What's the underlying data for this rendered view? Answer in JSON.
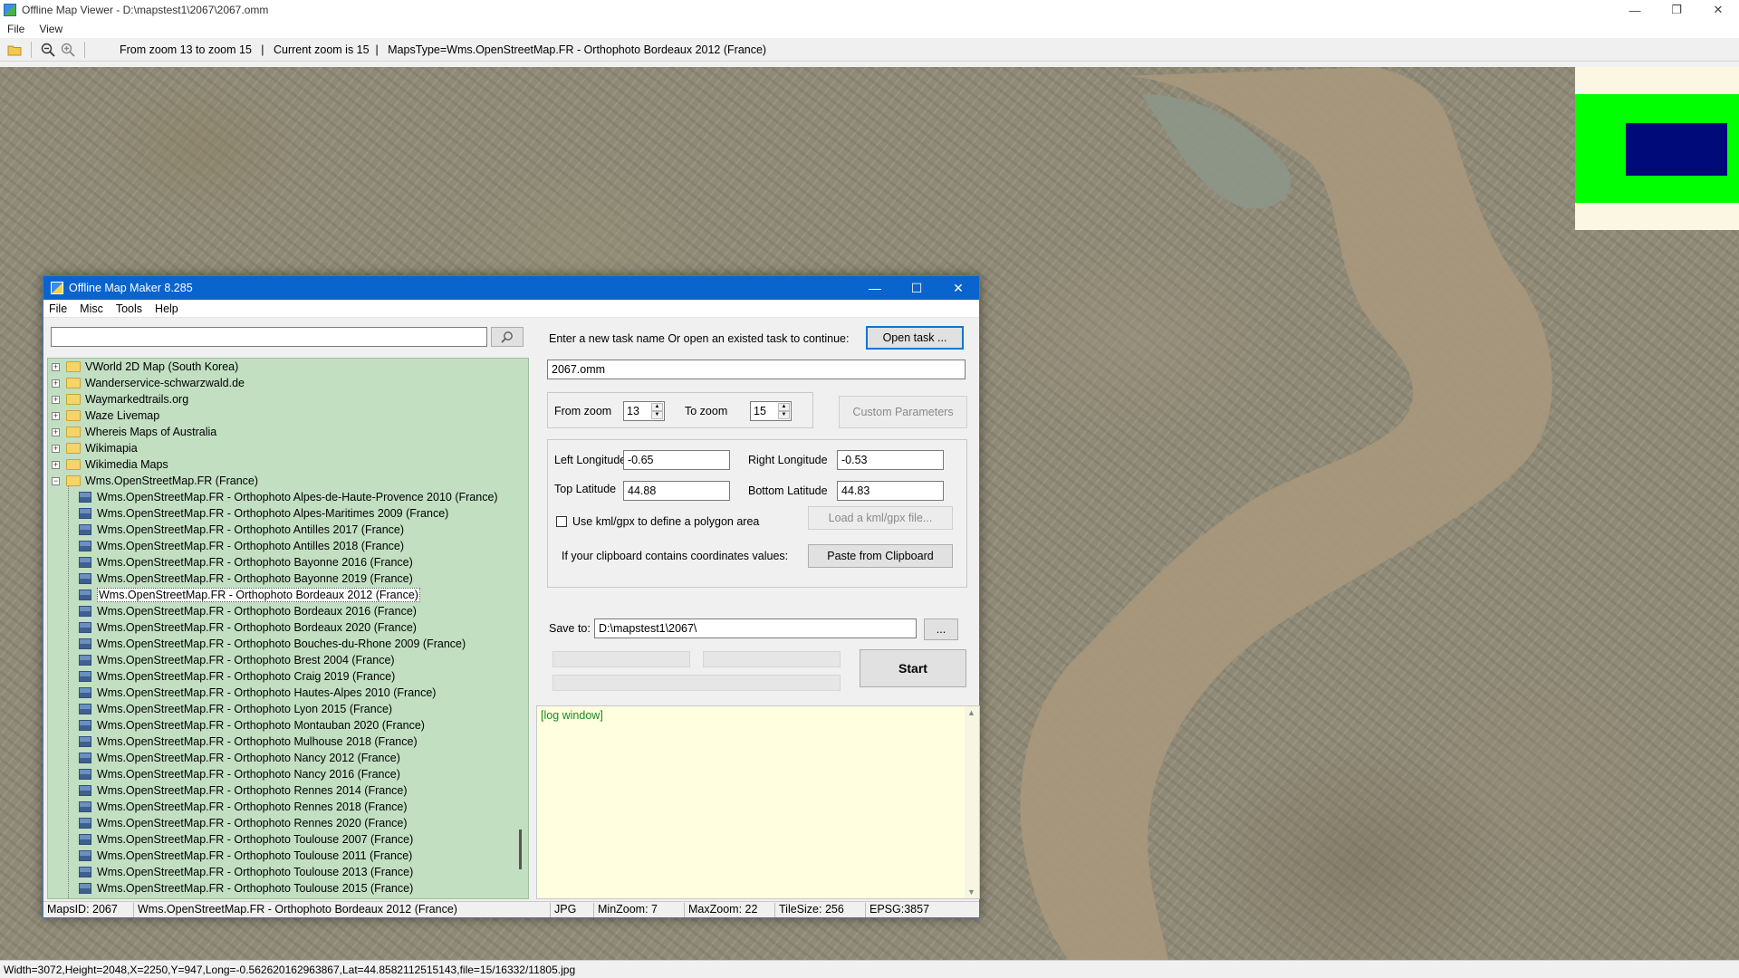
{
  "viewer": {
    "title": "Offline Map Viewer - D:\\mapstest1\\2067\\2067.omm",
    "menu": [
      "File",
      "View"
    ],
    "toolbar_status": "From zoom 13 to zoom 15   |   Current zoom is 15  |   MapsType=Wms.OpenStreetMap.FR - Orthophoto Bordeaux 2012 (France)",
    "status": "Width=3072,Height=2048,X=2250,Y=947,Long=-0.562620162963867,Lat=44.8582112515143,file=15/16332/11805.jpg",
    "icons": [
      "open-folder-icon",
      "zoom-out-icon",
      "zoom-in-icon"
    ],
    "colors": {
      "overview_bg": "#fbf7e3",
      "overview_area": "#00ff00",
      "overview_view": "#000a78",
      "river": "#a6977c"
    }
  },
  "dialog": {
    "title": "Offline Map Maker 8.285",
    "menu": [
      "File",
      "Misc",
      "Tools",
      "Help"
    ],
    "search": {
      "value": "",
      "placeholder": ""
    },
    "tree": {
      "folders": [
        "VWorld 2D Map (South Korea)",
        "Wanderservice-schwarzwald.de",
        "Waymarkedtrails.org",
        "Waze Livemap",
        "Whereis Maps of Australia",
        "Wikimapia",
        "Wikimedia Maps"
      ],
      "expanded_folder": "Wms.OpenStreetMap.FR (France)",
      "items": [
        "Wms.OpenStreetMap.FR - Orthophoto Alpes-de-Haute-Provence 2010 (France)",
        "Wms.OpenStreetMap.FR - Orthophoto Alpes-Maritimes 2009 (France)",
        "Wms.OpenStreetMap.FR - Orthophoto Antilles 2017 (France)",
        "Wms.OpenStreetMap.FR - Orthophoto Antilles 2018 (France)",
        "Wms.OpenStreetMap.FR - Orthophoto Bayonne 2016 (France)",
        "Wms.OpenStreetMap.FR - Orthophoto Bayonne 2019 (France)",
        "Wms.OpenStreetMap.FR - Orthophoto Bordeaux 2012 (France)",
        "Wms.OpenStreetMap.FR - Orthophoto Bordeaux 2016 (France)",
        "Wms.OpenStreetMap.FR - Orthophoto Bordeaux 2020 (France)",
        "Wms.OpenStreetMap.FR - Orthophoto Bouches-du-Rhone 2009 (France)",
        "Wms.OpenStreetMap.FR - Orthophoto Brest 2004 (France)",
        "Wms.OpenStreetMap.FR - Orthophoto Craig 2019 (France)",
        "Wms.OpenStreetMap.FR - Orthophoto Hautes-Alpes 2010 (France)",
        "Wms.OpenStreetMap.FR - Orthophoto Lyon 2015 (France)",
        "Wms.OpenStreetMap.FR - Orthophoto Montauban 2020 (France)",
        "Wms.OpenStreetMap.FR - Orthophoto Mulhouse 2018 (France)",
        "Wms.OpenStreetMap.FR - Orthophoto Nancy 2012 (France)",
        "Wms.OpenStreetMap.FR - Orthophoto Nancy 2016 (France)",
        "Wms.OpenStreetMap.FR - Orthophoto Rennes 2014 (France)",
        "Wms.OpenStreetMap.FR - Orthophoto Rennes 2018 (France)",
        "Wms.OpenStreetMap.FR - Orthophoto Rennes 2020 (France)",
        "Wms.OpenStreetMap.FR - Orthophoto Toulouse 2007 (France)",
        "Wms.OpenStreetMap.FR - Orthophoto Toulouse 2011 (France)",
        "Wms.OpenStreetMap.FR - Orthophoto Toulouse 2013 (France)",
        "Wms.OpenStreetMap.FR - Orthophoto Toulouse 2015 (France)"
      ],
      "selected_item": "Wms.OpenStreetMap.FR - Orthophoto Bordeaux 2012 (France)",
      "tree_bg": "#c2dfc2"
    },
    "task": {
      "prompt": "Enter a new task name Or open an existed task to continue:",
      "open_button": "Open task ...",
      "name_value": "2067.omm"
    },
    "zoom": {
      "from_label": "From zoom",
      "from_value": "13",
      "to_label": "To zoom",
      "to_value": "15",
      "custom_button": "Custom Parameters"
    },
    "coords": {
      "left_lon_label": "Left Longitude",
      "left_lon": "-0.65",
      "right_lon_label": "Right Longitude",
      "right_lon": "-0.53",
      "top_lat_label": "Top Latitude",
      "top_lat": "44.88",
      "bottom_lat_label": "Bottom Latitude",
      "bottom_lat": "44.83",
      "kml_checkbox_label": "Use kml/gpx to define a polygon area",
      "kml_checked": false,
      "load_kml_button": "Load a kml/gpx file...",
      "clipboard_label": "If your clipboard contains coordinates values:",
      "paste_button": "Paste from Clipboard"
    },
    "save": {
      "label": "Save to:",
      "path": "D:\\mapstest1\\2067\\",
      "browse_button": "...",
      "start_button": "Start"
    },
    "log": {
      "label": "[log window]",
      "bg": "#ffffe0"
    },
    "status": {
      "maps_id": "MapsID: 2067",
      "map_name": "Wms.OpenStreetMap.FR - Orthophoto Bordeaux 2012 (France)",
      "format": "JPG",
      "min_zoom": "MinZoom: 7",
      "max_zoom": "MaxZoom: 22",
      "tile_size": "TileSize: 256",
      "epsg": "EPSG:3857"
    }
  }
}
